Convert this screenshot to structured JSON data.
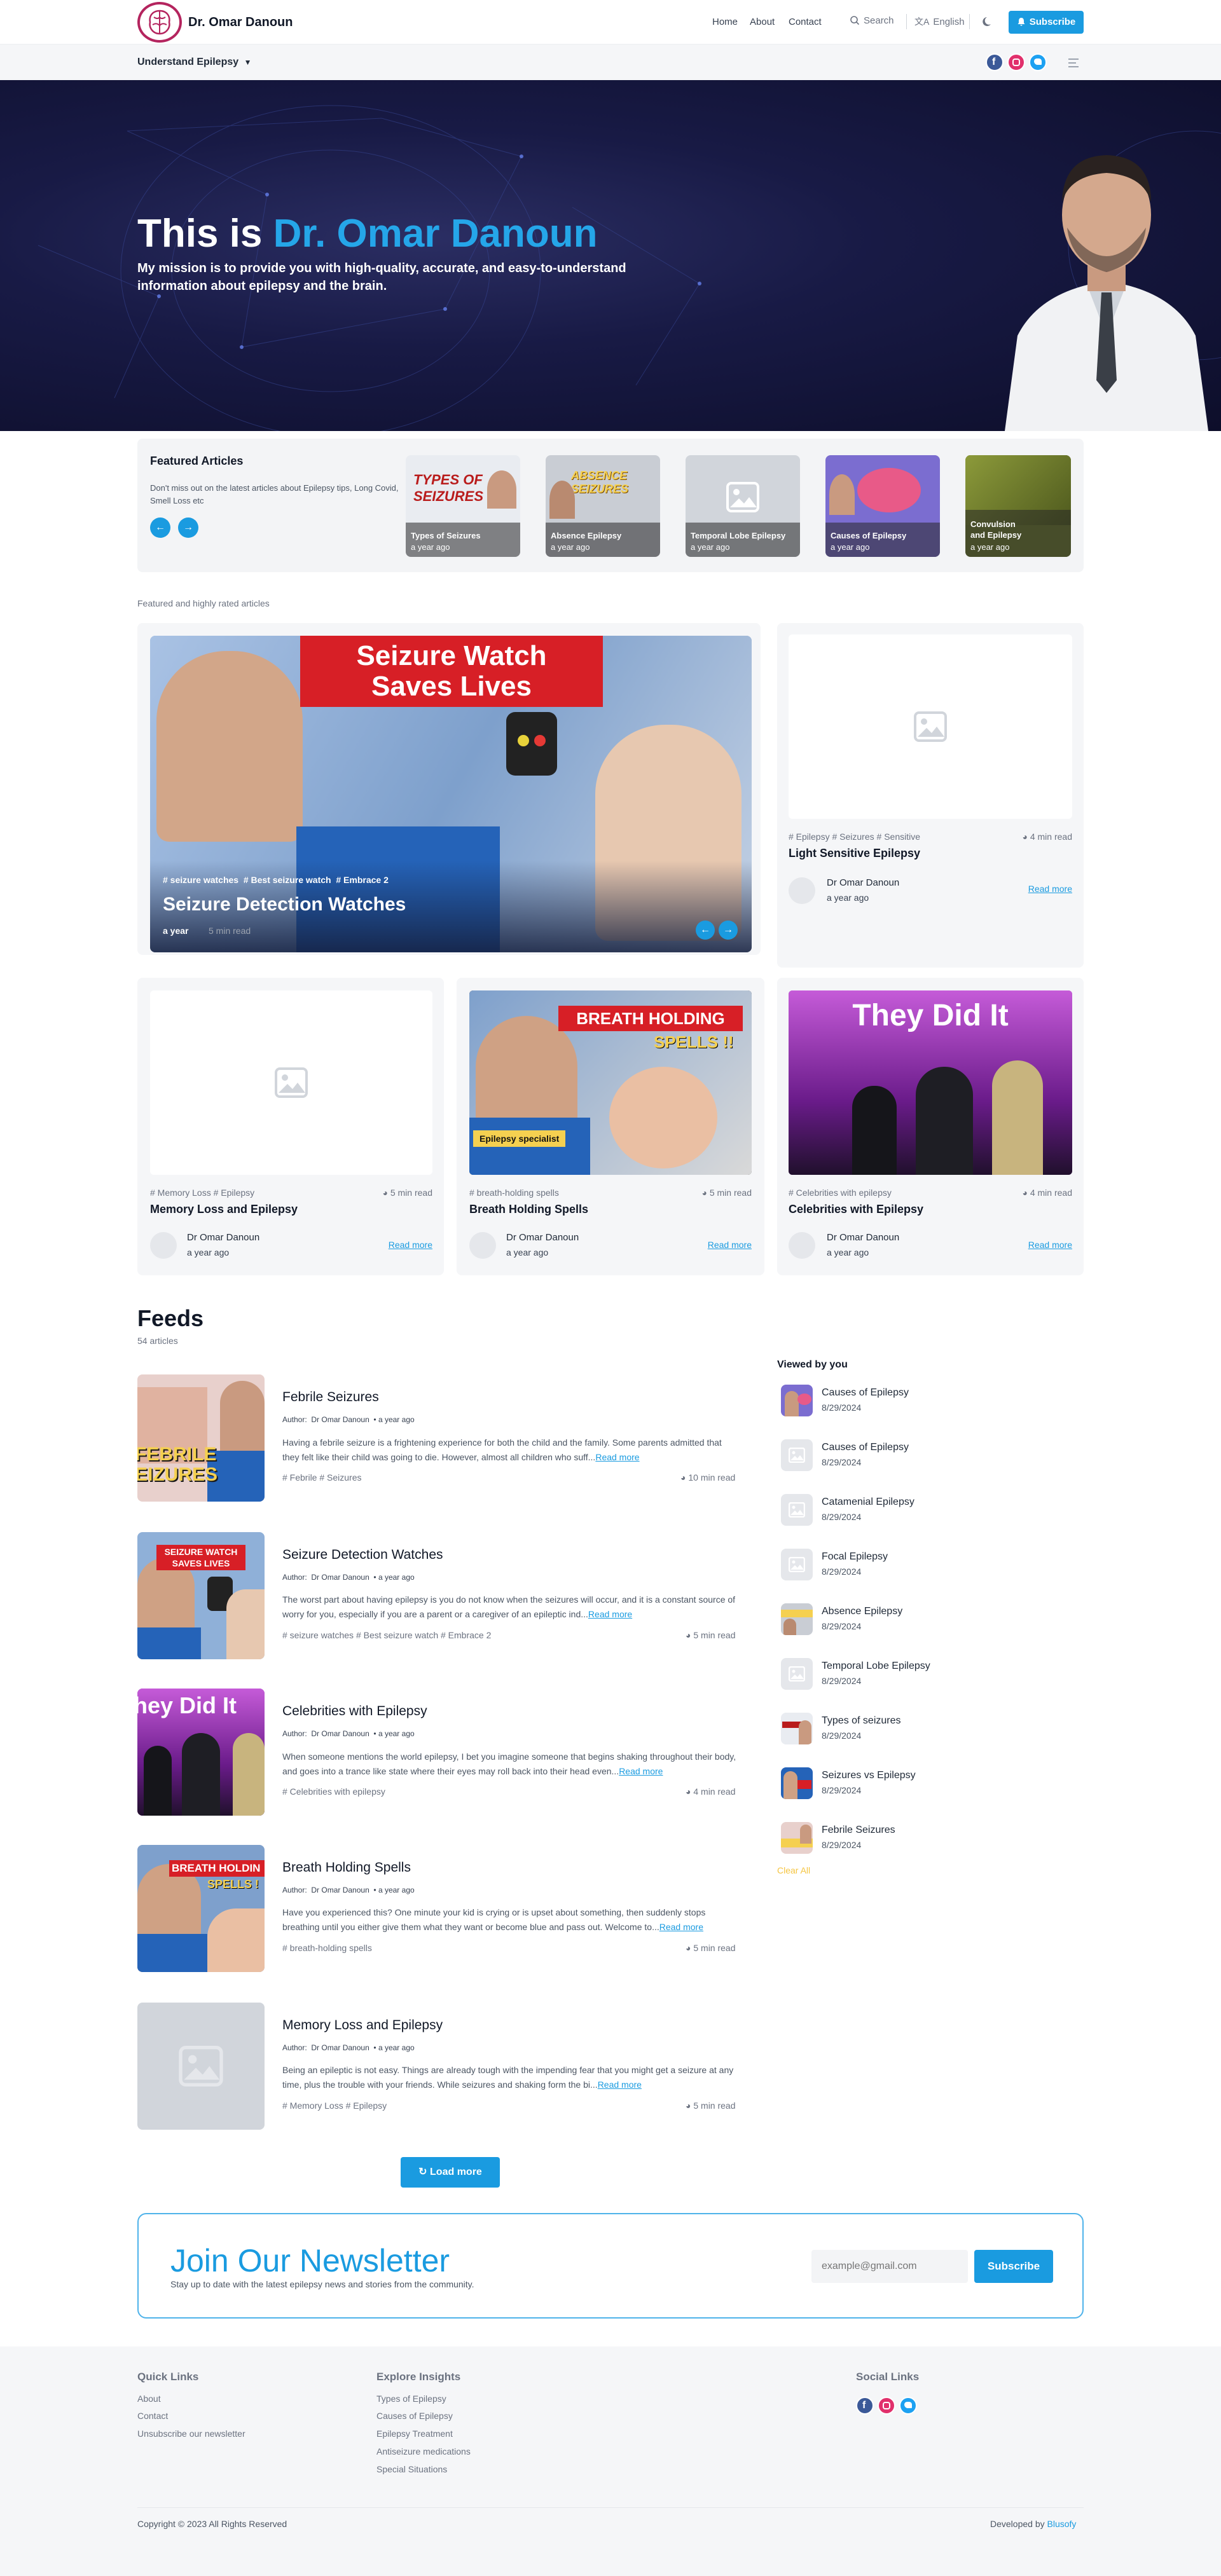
{
  "header": {
    "site_title": "Dr. Omar Danoun",
    "nav": [
      "Home",
      "About",
      "Contact"
    ],
    "search_label": "Search",
    "language": "English",
    "subscribe_label": "Subscribe",
    "menu_label": "Understand Epilepsy",
    "social_icons": [
      "facebook-icon",
      "instagram-icon",
      "twitter-icon"
    ]
  },
  "hero": {
    "title_prefix": "This is ",
    "title_name": "Dr. Omar Danoun",
    "subtitle": "My mission is to provide you with high-quality, accurate, and easy-to-understand information about epilepsy and the brain."
  },
  "featured": {
    "title": "Featured Articles",
    "description": "Don't miss out on the latest articles about Epilepsy tips, Long Covid, Smell Loss etc",
    "cards": [
      {
        "title": "Types of Seizures",
        "date": "a year ago"
      },
      {
        "title": "Absence Epilepsy",
        "date": "a year ago"
      },
      {
        "title": "Temporal Lobe Epilepsy",
        "date": "a year ago"
      },
      {
        "title": "Causes of Epilepsy",
        "date": "a year ago"
      },
      {
        "title": "Convulsion and Epilepsy",
        "date": "a year ago"
      }
    ]
  },
  "highlights": {
    "label": "Featured and highly rated articles",
    "main": {
      "tags": [
        "# seizure watches",
        "# Best seizure watch",
        "# Embrace 2"
      ],
      "title": "Seizure Detection Watches",
      "date": "a year",
      "read_time": "5 min read",
      "banner": [
        "Seizure Watch",
        "Saves Lives"
      ]
    },
    "cards": [
      {
        "tags": "# Epilepsy  # Seizures  # Sensitive",
        "read_time": "4 min read",
        "title": "Light Sensitive Epilepsy",
        "author": "Dr Omar Danoun",
        "date": "a year ago",
        "read_more": "Read more"
      },
      {
        "tags": "# Memory Loss  # Epilepsy",
        "read_time": "5 min read",
        "title": "Memory Loss and Epilepsy",
        "author": "Dr Omar Danoun",
        "date": "a year ago",
        "read_more": "Read more"
      },
      {
        "tags": "# breath-holding spells",
        "read_time": "5 min read",
        "title": "Breath Holding Spells",
        "author": "Dr Omar Danoun",
        "date": "a year ago",
        "read_more": "Read more",
        "thumb_text": [
          "BREATH HOLDING",
          "SPELLS !!"
        ],
        "thumb_caption": "Epilepsy specialist"
      },
      {
        "tags": "# Celebrities with epilepsy",
        "read_time": "4 min read",
        "title": "Celebrities with Epilepsy",
        "author": "Dr Omar Danoun",
        "date": "a year ago",
        "read_more": "Read more",
        "thumb_text": [
          "They Did It"
        ]
      }
    ]
  },
  "feeds": {
    "title": "Feeds",
    "count": "54 articles",
    "author_label": "Author:",
    "items": [
      {
        "title": "Febrile Seizures",
        "author": "Dr Omar Danoun",
        "date": "a year ago",
        "excerpt": "Having a febrile seizure is a frightening experience for both the child and the family. Some parents admitted that they felt like their child was going to die. However, almost all children who suff...",
        "read_more": "Read more",
        "tags": "# Febrile  # Seizures",
        "read_time": "10 min read",
        "thumb_text": [
          "FEBRILE",
          "EIZURES"
        ]
      },
      {
        "title": "Seizure Detection Watches",
        "author": "Dr Omar Danoun",
        "date": "a year ago",
        "excerpt": "The worst part about having epilepsy is you do not know when the seizures will occur, and it is a constant source of worry for you, especially if you are a parent or a caregiver of an epileptic ind...",
        "read_more": "Read more",
        "tags": "# seizure watches  # Best seizure watch  # Embrace 2",
        "read_time": "5 min read",
        "thumb_text": [
          "SEIZURE WATCH",
          "SAVES LIVES"
        ]
      },
      {
        "title": "Celebrities with Epilepsy",
        "author": "Dr Omar Danoun",
        "date": "a year ago",
        "excerpt": "When someone mentions the world epilepsy, I bet you imagine someone that begins shaking throughout their body, and goes into a trance like state where their eyes may roll back into their head even...",
        "read_more": "Read more",
        "tags": "# Celebrities with epilepsy",
        "read_time": "4 min read",
        "thumb_text": [
          "hey Did It"
        ]
      },
      {
        "title": "Breath Holding Spells",
        "author": "Dr Omar Danoun",
        "date": "a year ago",
        "excerpt": "Have you experienced this? One minute your kid is crying or is upset about something, then suddenly stops breathing until you either give them what they want or become blue and pass out. Welcome to...",
        "read_more": "Read more",
        "tags": "# breath-holding spells",
        "read_time": "5 min read",
        "thumb_text": [
          "BREATH HOLDIN",
          "SPELLS !"
        ]
      },
      {
        "title": "Memory Loss and Epilepsy",
        "author": "Dr Omar Danoun",
        "date": "a year ago",
        "excerpt": "Being an epileptic is not easy. Things are already tough with the impending fear that you might get a seizure at any time, plus the trouble with your friends. While seizures and shaking form the bi...",
        "read_more": "Read more",
        "tags": "# Memory Loss  # Epilepsy",
        "read_time": "5 min read"
      }
    ],
    "load_more": "Load more"
  },
  "viewed": {
    "title": "Viewed by you",
    "items": [
      {
        "name": "Causes of Epilepsy",
        "date": "8/29/2024"
      },
      {
        "name": "Causes of Epilepsy",
        "date": "8/29/2024"
      },
      {
        "name": "Catamenial Epilepsy",
        "date": "8/29/2024"
      },
      {
        "name": "Focal Epilepsy",
        "date": "8/29/2024"
      },
      {
        "name": "Absence Epilepsy",
        "date": "8/29/2024"
      },
      {
        "name": "Temporal Lobe Epilepsy",
        "date": "8/29/2024"
      },
      {
        "name": "Types of seizures",
        "date": "8/29/2024"
      },
      {
        "name": "Seizures vs Epilepsy",
        "date": "8/29/2024"
      },
      {
        "name": "Febrile Seizures",
        "date": "8/29/2024"
      }
    ],
    "clear_all": "Clear All"
  },
  "newsletter": {
    "title": "Join Our Newsletter",
    "subtitle": "Stay up to date with the latest epilepsy news and stories from the community.",
    "placeholder": "example@gmail.com",
    "button": "Subscribe"
  },
  "footer": {
    "quick_links_title": "Quick Links",
    "quick_links": [
      "About",
      "Contact",
      "Unsubscribe our newsletter"
    ],
    "explore_title": "Explore Insights",
    "explore": [
      "Types of Epilepsy",
      "Causes of Epilepsy",
      "Epilepsy Treatment",
      "Antiseizure medications",
      "Special Situations"
    ],
    "social_title": "Social Links",
    "copyright": "Copyright © 2023 All Rights Reserved",
    "developed_by": "Developed by",
    "developer": "Blusofy"
  },
  "colors": {
    "accent": "#1a9be0",
    "brand": "#b4245e",
    "hero_bg": "#181a45"
  }
}
